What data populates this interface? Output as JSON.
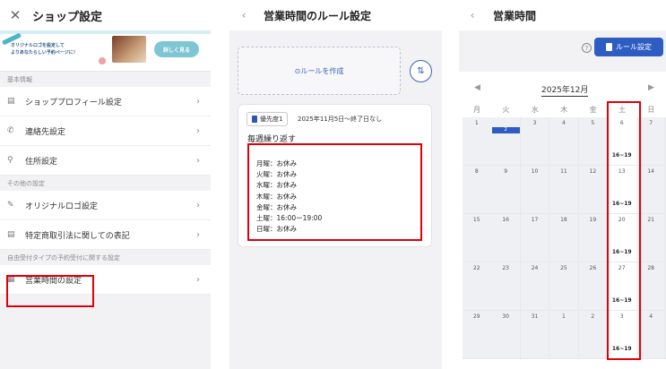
{
  "shop_settings": {
    "title": "ショップ設定",
    "banner": {
      "line1": "オリジナルロゴを設定して",
      "line2": "よりあなたらしい予約ページに！",
      "button": "詳しく見る"
    },
    "sections": [
      {
        "label": "基本情報",
        "items": [
          {
            "label": "ショッププロフィール設定",
            "icon": "profile-card-icon",
            "glyph": "▤"
          },
          {
            "label": "連絡先設定",
            "icon": "phone-icon",
            "glyph": "✆"
          },
          {
            "label": "住所設定",
            "icon": "location-pin-icon",
            "glyph": "⚲"
          }
        ]
      },
      {
        "label": "その他の設定",
        "items": [
          {
            "label": "オリジナルロゴ設定",
            "icon": "logo-pen-icon",
            "glyph": "✎"
          },
          {
            "label": "特定商取引法に関しての表記",
            "icon": "document-icon",
            "glyph": "▤"
          }
        ]
      },
      {
        "label": "自由受付タイプの予約受付に関する設定",
        "items": [
          {
            "label": "営業時間の設定",
            "icon": "business-hours-icon",
            "glyph": "▦"
          }
        ]
      }
    ]
  },
  "rule_settings": {
    "title": "営業時間のルール設定",
    "create_label": "⊙ルールを作成",
    "rule": {
      "priority": "優先度1",
      "period": "2025年11月5日〜終了日なし",
      "repeat": "毎週繰り返す",
      "days": [
        "月曜：お休み",
        "火曜：お休み",
        "水曜：お休み",
        "木曜：お休み",
        "金曜：お休み",
        "土曜：16:00ー19:00",
        "日曜：お休み"
      ]
    }
  },
  "business_hours": {
    "title": "営業時間",
    "rule_button": "ルール設定",
    "month": "2025年12月",
    "weekdays": [
      "月",
      "火",
      "水",
      "木",
      "金",
      "土",
      "日"
    ],
    "weeks": [
      [
        "1",
        "2",
        "3",
        "4",
        "5",
        "6",
        "7"
      ],
      [
        "8",
        "9",
        "10",
        "11",
        "12",
        "13",
        "14"
      ],
      [
        "15",
        "16",
        "17",
        "18",
        "19",
        "20",
        "21"
      ],
      [
        "22",
        "23",
        "24",
        "25",
        "26",
        "27",
        "28"
      ],
      [
        "29",
        "30",
        "31",
        "1",
        "2",
        "3",
        "4"
      ]
    ],
    "saturday_hours": "16~19"
  },
  "colors": {
    "accent": "#2d5cc2",
    "highlight": "#e0000b"
  }
}
